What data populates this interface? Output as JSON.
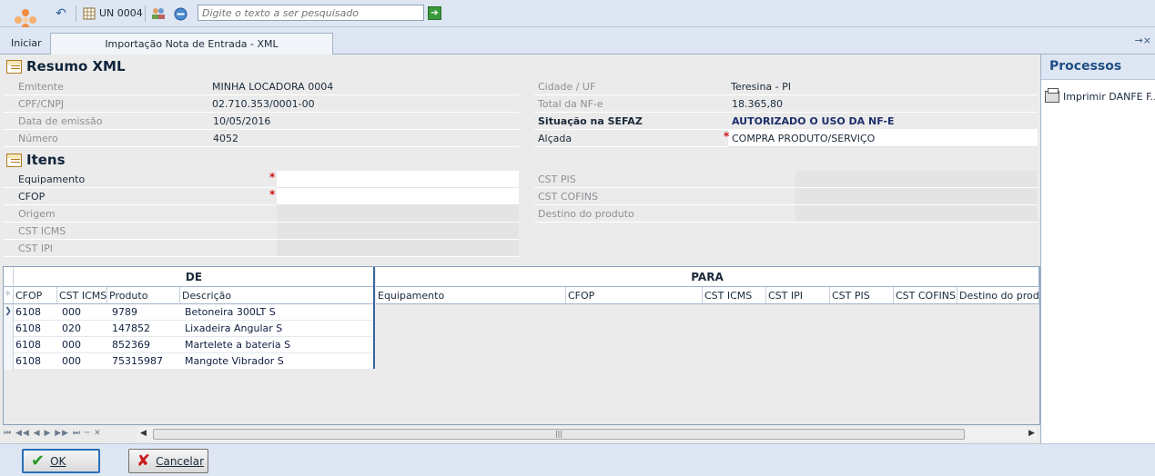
{
  "toolbar": {
    "unit_label": "UN 0004",
    "search_placeholder": "Digite o texto a ser pesquisado"
  },
  "nav": {
    "start_label": "Iniciar",
    "tab_label": "Importação Nota de Entrada - XML",
    "tab_arrows": "→×"
  },
  "resumo": {
    "title": "Resumo XML",
    "fields": {
      "emitente_label": "Emitente",
      "emitente_value": "MINHA LOCADORA 0004",
      "cnpj_label": "CPF/CNPJ",
      "cnpj_value": "02.710.353/0001-00",
      "data_label": "Data de emissão",
      "data_value": "10/05/2016",
      "numero_label": "Número",
      "numero_value": "4052",
      "cidade_label": "Cidade / UF",
      "cidade_value": "Teresina - PI",
      "total_label": "Total da NF-e",
      "total_value": "18.365,80",
      "situacao_label": "Situação na SEFAZ",
      "situacao_value": "AUTORIZADO O USO DA NF-E",
      "alcada_label": "Alçada",
      "alcada_value": "COMPRA PRODUTO/SERVIÇO"
    }
  },
  "itens": {
    "title": "Itens",
    "equipamento_label": "Equipamento",
    "cfop_label": "CFOP",
    "origem_label": "Origem",
    "csticms_label": "CST ICMS",
    "cstipi_label": "CST IPI",
    "cstpis_label": "CST PIS",
    "cstcofins_label": "CST COFINS",
    "destino_label": "Destino do produto",
    "required_mark": "*"
  },
  "grid": {
    "band_de": "DE",
    "band_para": "PARA",
    "de_columns": [
      "CFOP",
      "CST ICMS",
      "Produto",
      "Descrição"
    ],
    "para_columns": [
      "Equipamento",
      "CFOP",
      "CST ICMS",
      "CST IPI",
      "CST PIS",
      "CST COFINS",
      "Destino do produto"
    ],
    "rows": [
      {
        "cfop": "6108",
        "csticms": "000",
        "produto": "9789",
        "descricao": "Betoneira 300LT S"
      },
      {
        "cfop": "6108",
        "csticms": "020",
        "produto": "147852",
        "descricao": "Lixadeira Angular S"
      },
      {
        "cfop": "6108",
        "csticms": "000",
        "produto": "852369",
        "descricao": "Martelete a bateria S"
      },
      {
        "cfop": "6108",
        "csticms": "000",
        "produto": "75315987",
        "descricao": "Mangote Vibrador S"
      }
    ]
  },
  "processos": {
    "title": "Processos",
    "item_label": "Imprimir DANFE F..."
  },
  "buttons": {
    "ok_label": "OK",
    "cancel_label": "Cancelar"
  }
}
